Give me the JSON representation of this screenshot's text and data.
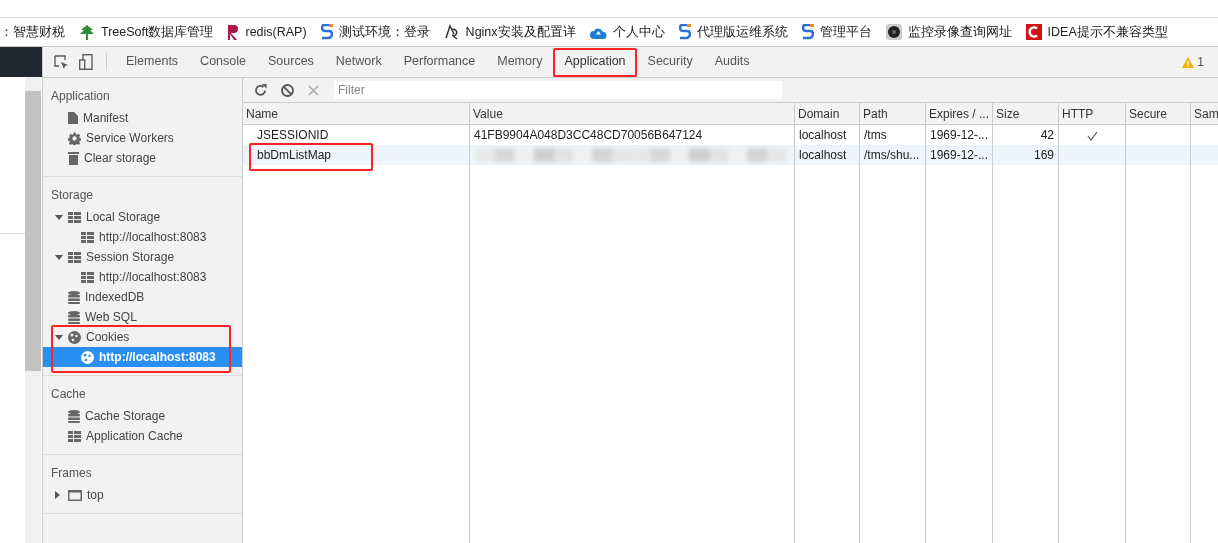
{
  "bookmarks": [
    {
      "label": "：智慧财税",
      "kind": "none"
    },
    {
      "label": "TreeSoft数据库管理",
      "kind": "tree"
    },
    {
      "label": "redis(RAP)",
      "kind": "r"
    },
    {
      "label": "测试环境：登录",
      "kind": "s"
    },
    {
      "label": "Nginx安装及配置详",
      "kind": "nginx"
    },
    {
      "label": "个人中心",
      "kind": "cloud"
    },
    {
      "label": "代理版运维系统",
      "kind": "s"
    },
    {
      "label": "管理平台",
      "kind": "s"
    },
    {
      "label": "监控录像查询网址",
      "kind": "camera"
    },
    {
      "label": "IDEA提示不兼容类型",
      "kind": "c"
    }
  ],
  "tabs": [
    {
      "label": "Elements",
      "selected": false,
      "annotated": false
    },
    {
      "label": "Console",
      "selected": false,
      "annotated": false
    },
    {
      "label": "Sources",
      "selected": false,
      "annotated": false
    },
    {
      "label": "Network",
      "selected": false,
      "annotated": false
    },
    {
      "label": "Performance",
      "selected": false,
      "annotated": false
    },
    {
      "label": "Memory",
      "selected": false,
      "annotated": false
    },
    {
      "label": "Application",
      "selected": true,
      "annotated": true
    },
    {
      "label": "Security",
      "selected": false,
      "annotated": false
    },
    {
      "label": "Audits",
      "selected": false,
      "annotated": false
    }
  ],
  "warnings": "1",
  "sidebar": [
    {
      "title": "Application",
      "items": [
        {
          "label": "Manifest",
          "kind": "file",
          "selected": false,
          "annotated": false
        },
        {
          "label": "Service Workers",
          "kind": "gear",
          "selected": false,
          "annotated": false
        },
        {
          "label": "Clear storage",
          "kind": "trash",
          "selected": false,
          "annotated": false
        }
      ]
    },
    {
      "title": "Storage",
      "items": [
        {
          "label": "Local Storage",
          "kind": "grid",
          "expanded": true,
          "selected": false,
          "annotated": false,
          "children": [
            {
              "label": "http://localhost:8083",
              "kind": "grid",
              "selected": false
            }
          ]
        },
        {
          "label": "Session Storage",
          "kind": "grid",
          "expanded": true,
          "selected": false,
          "annotated": false,
          "children": [
            {
              "label": "http://localhost:8083",
              "kind": "grid",
              "selected": false
            }
          ]
        },
        {
          "label": "IndexedDB",
          "kind": "db",
          "selected": false,
          "annotated": false
        },
        {
          "label": "Web SQL",
          "kind": "db",
          "selected": false,
          "annotated": false
        },
        {
          "label": "Cookies",
          "kind": "cookie",
          "expanded": true,
          "selected": false,
          "annotated": true,
          "children": [
            {
              "label": "http://localhost:8083",
              "kind": "cookie",
              "selected": true
            }
          ]
        }
      ]
    },
    {
      "title": "Cache",
      "items": [
        {
          "label": "Cache Storage",
          "kind": "db",
          "selected": false,
          "annotated": false
        },
        {
          "label": "Application Cache",
          "kind": "grid",
          "selected": false,
          "annotated": false
        }
      ]
    },
    {
      "title": "Frames",
      "items": [
        {
          "label": "top",
          "kind": "frame",
          "expanded": false,
          "selected": false,
          "annotated": false
        }
      ]
    }
  ],
  "filter": {
    "placeholder": "Filter"
  },
  "table": {
    "columns": [
      "Name",
      "Value",
      "Domain",
      "Path",
      "Expires / ...",
      "Size",
      "HTTP",
      "Secure",
      "Sam"
    ],
    "rows": [
      {
        "name": "JSESSIONID",
        "value": "41FB9904A048D3CC48CD70056B647124",
        "value_redacted": false,
        "domain": "localhost",
        "path": "/tms",
        "expires": "1969-12-...",
        "size": "42",
        "http": true,
        "selected": false,
        "annotated": false
      },
      {
        "name": "bbDmListMap",
        "value_redacted": true,
        "domain": "localhost",
        "path": "/tms/shu...",
        "expires": "1969-12-...",
        "size": "169",
        "http": false,
        "selected": true,
        "annotated": true
      }
    ]
  }
}
